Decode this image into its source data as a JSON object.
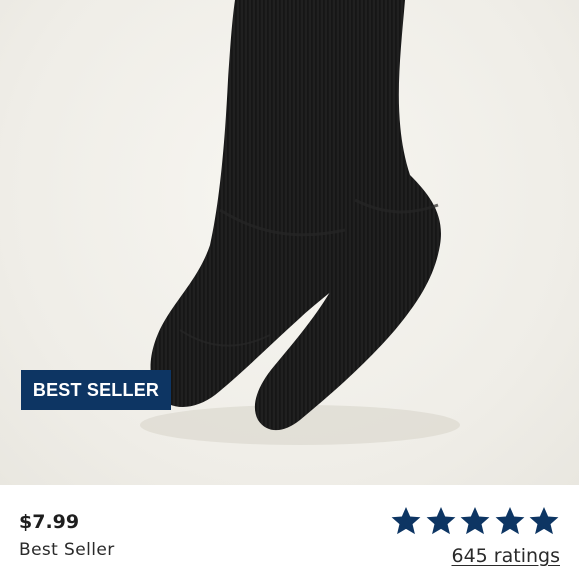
{
  "product": {
    "badge_label": "BEST SELLER",
    "price": "$7.99",
    "subtitle": "Best Seller",
    "rating": {
      "stars_filled": 5,
      "stars_total": 5,
      "ratings_text": "645 ratings"
    }
  },
  "colors": {
    "badge_bg": "#0d3563",
    "star_fill": "#0d3563",
    "image_bg": "#efede7",
    "sock": "#1a1a1a"
  },
  "icons": {
    "star": "star-icon"
  }
}
